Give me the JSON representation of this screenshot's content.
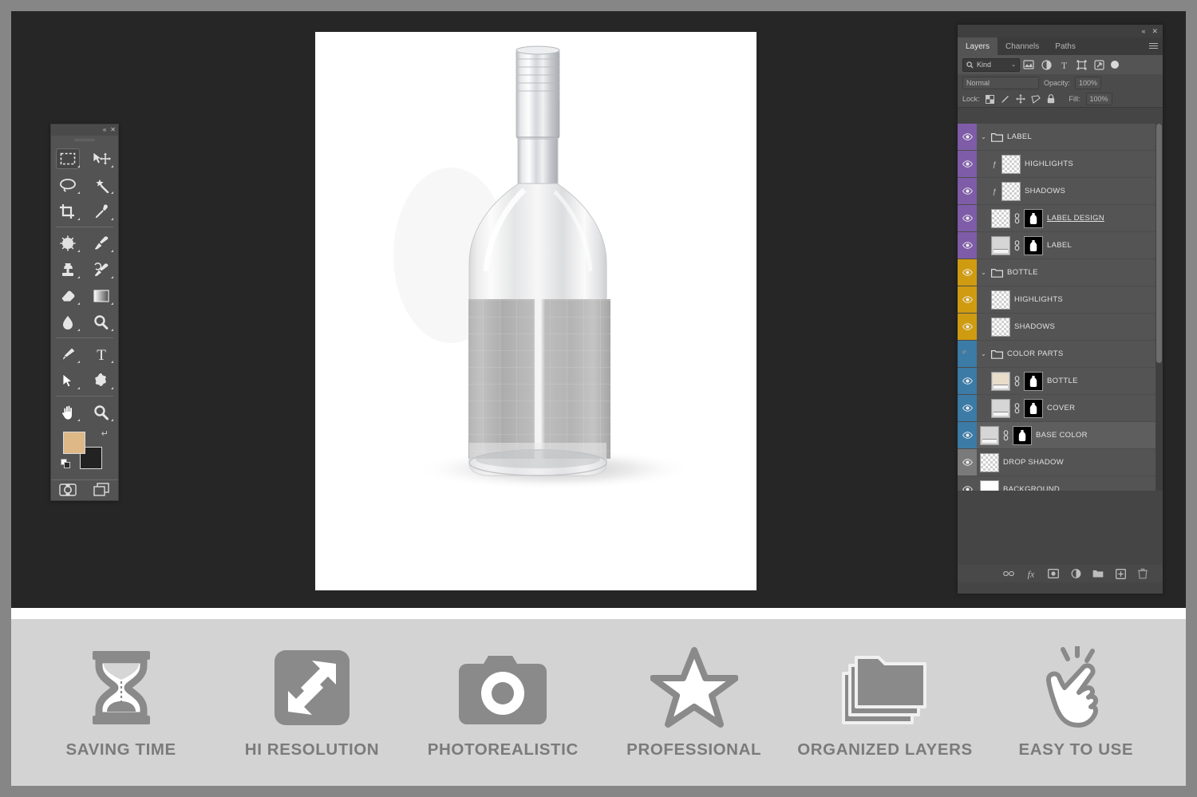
{
  "colors": {
    "frame": "#868686",
    "editor_bg": "#262626",
    "panel_bg": "#545454",
    "feature_bar_bg": "#d3d3d3",
    "label_group": "#7e5ca8",
    "bottle_group": "#cf9b11",
    "color_parts_group": "#3b7ba6",
    "drop_shadow_group": "#7a7a7a",
    "foreground_swatch": "#deb887",
    "background_swatch": "#222222"
  },
  "tools_panel": {
    "collapse_label": "«",
    "close_label": "✕",
    "tools": [
      {
        "name": "rectangular-marquee-tool",
        "active": true
      },
      {
        "name": "move-tool",
        "active": false
      },
      {
        "name": "lasso-tool",
        "active": false
      },
      {
        "name": "magic-wand-tool",
        "active": false
      },
      {
        "name": "crop-tool",
        "active": false
      },
      {
        "name": "eyedropper-tool",
        "active": false
      },
      {
        "name": "spot-healing-brush-tool",
        "active": false
      },
      {
        "name": "brush-tool",
        "active": false
      },
      {
        "name": "clone-stamp-tool",
        "active": false
      },
      {
        "name": "history-brush-tool",
        "active": false
      },
      {
        "name": "eraser-tool",
        "active": false
      },
      {
        "name": "gradient-tool",
        "active": false
      },
      {
        "name": "blur-tool",
        "active": false
      },
      {
        "name": "dodge-tool",
        "active": false
      },
      {
        "name": "pen-tool",
        "active": false
      },
      {
        "name": "type-tool",
        "active": false
      },
      {
        "name": "path-selection-tool",
        "active": false
      },
      {
        "name": "custom-shape-tool",
        "active": false
      },
      {
        "name": "hand-tool",
        "active": false
      },
      {
        "name": "zoom-tool",
        "active": false
      }
    ],
    "screen_mode": "screen-mode-button",
    "quick_mask": "quick-mask-button"
  },
  "layers_panel": {
    "collapse_label": "«",
    "close_label": "✕",
    "tabs": [
      {
        "label": "Layers",
        "active": true
      },
      {
        "label": "Channels",
        "active": false
      },
      {
        "label": "Paths",
        "active": false
      }
    ],
    "filter": {
      "kind_label": "Kind",
      "caret": "⌄",
      "icons": [
        "filter-pixel-icon",
        "filter-adjustment-icon",
        "filter-type-icon",
        "filter-shape-icon",
        "filter-smart-object-icon"
      ]
    },
    "blend": {
      "mode": "Normal",
      "opacity_label": "Opacity:",
      "opacity_value": "100%"
    },
    "locks": {
      "label": "Lock:",
      "fill_label": "Fill:",
      "fill_value": "100%"
    },
    "layers": [
      {
        "name": "LABEL",
        "type": "group",
        "indent": 0,
        "color": "#7e5ca8",
        "visible": true,
        "thumb": "none",
        "mask": false,
        "fx": false,
        "expanded": true,
        "selected": false
      },
      {
        "name": "HIGHLIGHTS",
        "type": "layer",
        "indent": 1,
        "color": "#7e5ca8",
        "visible": true,
        "thumb": "transparent",
        "mask": false,
        "fx": true,
        "expanded": false,
        "selected": false
      },
      {
        "name": "SHADOWS",
        "type": "layer",
        "indent": 1,
        "color": "#7e5ca8",
        "visible": true,
        "thumb": "transparent",
        "mask": false,
        "fx": true,
        "expanded": false,
        "selected": false
      },
      {
        "name": "LABEL DESIGN",
        "type": "smart",
        "indent": 1,
        "color": "#7e5ca8",
        "visible": true,
        "thumb": "transparent",
        "mask": true,
        "fx": false,
        "expanded": false,
        "selected": false
      },
      {
        "name": "LABEL",
        "type": "layer",
        "indent": 1,
        "color": "#7e5ca8",
        "visible": true,
        "thumb": "screen",
        "mask": true,
        "fx": false,
        "expanded": false,
        "selected": false
      },
      {
        "name": "BOTTLE",
        "type": "group",
        "indent": 0,
        "color": "#cf9b11",
        "visible": true,
        "thumb": "none",
        "mask": false,
        "fx": false,
        "expanded": true,
        "selected": false
      },
      {
        "name": "HIGHLIGHTS",
        "type": "layer",
        "indent": 1,
        "color": "#cf9b11",
        "visible": true,
        "thumb": "transparent",
        "mask": false,
        "fx": false,
        "expanded": false,
        "selected": false
      },
      {
        "name": "SHADOWS",
        "type": "layer",
        "indent": 1,
        "color": "#cf9b11",
        "visible": true,
        "thumb": "transparent",
        "mask": false,
        "fx": false,
        "expanded": false,
        "selected": false
      },
      {
        "name": "COLOR PARTS",
        "type": "group",
        "indent": 0,
        "color": "#3b7ba6",
        "visible": false,
        "thumb": "none",
        "mask": false,
        "fx": false,
        "expanded": true,
        "selected": false
      },
      {
        "name": "BOTTLE",
        "type": "layer",
        "indent": 1,
        "color": "#3b7ba6",
        "visible": true,
        "thumb": "screen-beige",
        "mask": true,
        "fx": false,
        "expanded": false,
        "selected": false
      },
      {
        "name": "COVER",
        "type": "layer",
        "indent": 1,
        "color": "#3b7ba6",
        "visible": true,
        "thumb": "screen",
        "mask": true,
        "fx": false,
        "expanded": false,
        "selected": false
      },
      {
        "name": "BASE COLOR",
        "type": "layer",
        "indent": 0,
        "color": "#3b7ba6",
        "visible": true,
        "thumb": "screen",
        "mask": true,
        "fx": false,
        "expanded": false,
        "selected": true
      },
      {
        "name": "DROP SHADOW",
        "type": "layer",
        "indent": 0,
        "color": "#7a7a7a",
        "visible": true,
        "thumb": "transparent",
        "mask": false,
        "fx": false,
        "expanded": false,
        "selected": false
      },
      {
        "name": "BACKGROUND",
        "type": "layer",
        "indent": 0,
        "color": "#545454",
        "visible": true,
        "thumb": "screen-white",
        "mask": false,
        "fx": false,
        "expanded": false,
        "selected": false
      }
    ],
    "footer_buttons": [
      "link-layers-icon",
      "layer-style-icon",
      "add-layer-mask-icon",
      "new-adjustment-layer-icon",
      "new-group-icon",
      "new-layer-icon",
      "delete-layer-icon"
    ]
  },
  "features": [
    {
      "label": "SAVING TIME",
      "icon": "hourglass-icon"
    },
    {
      "label": "HI RESOLUTION",
      "icon": "resize-arrows-icon"
    },
    {
      "label": "PHOTOREALISTIC",
      "icon": "camera-icon"
    },
    {
      "label": "PROFESSIONAL",
      "icon": "star-icon"
    },
    {
      "label": "ORGANIZED LAYERS",
      "icon": "stacked-folders-icon"
    },
    {
      "label": "EASY TO USE",
      "icon": "tap-hand-icon"
    }
  ]
}
